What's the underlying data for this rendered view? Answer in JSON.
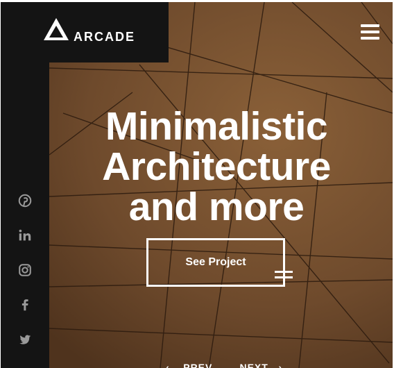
{
  "brand": {
    "name": "ARCADE"
  },
  "header": {
    "menu_icon": "hamburger-menu-icon"
  },
  "social": [
    {
      "name": "pinterest",
      "icon": "pinterest-icon"
    },
    {
      "name": "linkedin",
      "icon": "linkedin-icon"
    },
    {
      "name": "instagram",
      "icon": "instagram-icon"
    },
    {
      "name": "facebook",
      "icon": "facebook-icon"
    },
    {
      "name": "twitter",
      "icon": "twitter-icon"
    }
  ],
  "hero": {
    "headline_lines": [
      "Minimalistic",
      "Architecture",
      "and more"
    ],
    "cta_label": "See Project"
  },
  "pager": {
    "prev_arrow": "‹",
    "prev_label": "PREV",
    "next_label": "NEXT",
    "next_arrow": "›"
  },
  "colors": {
    "panel": "#141414",
    "text": "#ffffff",
    "icon_grey": "#9a9a9a",
    "background_brown": "#6e4a2c"
  }
}
